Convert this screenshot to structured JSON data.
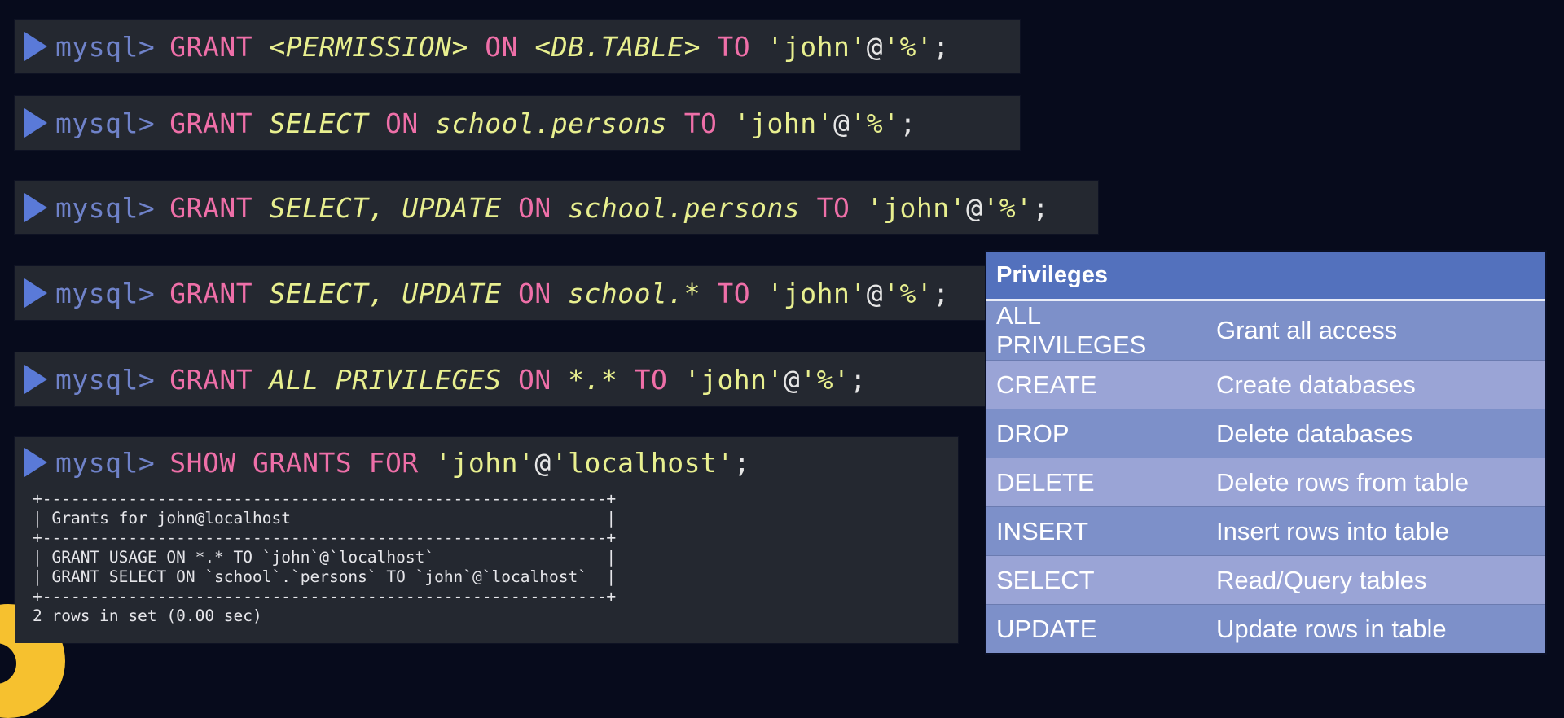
{
  "theme": {
    "background": "#070b1c",
    "terminal_bg": "#242830",
    "prompt_arrow": "#5a7ad8",
    "prompt_text": "#6f82c9",
    "keyword": "#ee6fa8",
    "argument": "#e8ef8f",
    "table_header": "#5371bd",
    "table_row_dark": "#7d90c9",
    "table_row_light": "#9aa4d6",
    "decoration": "#f6c12f"
  },
  "prompt": "mysql>",
  "commands": [
    {
      "tokens": [
        {
          "t": "GRANT",
          "c": "kw"
        },
        {
          "t": " ",
          "c": "punct"
        },
        {
          "t": "<PERMISSION>",
          "c": "arg"
        },
        {
          "t": " ",
          "c": "punct"
        },
        {
          "t": "ON",
          "c": "kw"
        },
        {
          "t": " ",
          "c": "punct"
        },
        {
          "t": "<DB.TABLE>",
          "c": "arg"
        },
        {
          "t": " ",
          "c": "punct"
        },
        {
          "t": "TO",
          "c": "kw"
        },
        {
          "t": " ",
          "c": "punct"
        },
        {
          "t": "'john'",
          "c": "str"
        },
        {
          "t": "@",
          "c": "punct"
        },
        {
          "t": "'%'",
          "c": "str"
        },
        {
          "t": ";",
          "c": "punct"
        }
      ]
    },
    {
      "tokens": [
        {
          "t": "GRANT",
          "c": "kw"
        },
        {
          "t": " ",
          "c": "punct"
        },
        {
          "t": "SELECT",
          "c": "arg"
        },
        {
          "t": " ",
          "c": "punct"
        },
        {
          "t": "ON",
          "c": "kw"
        },
        {
          "t": " ",
          "c": "punct"
        },
        {
          "t": "school.persons",
          "c": "arg"
        },
        {
          "t": " ",
          "c": "punct"
        },
        {
          "t": "TO",
          "c": "kw"
        },
        {
          "t": " ",
          "c": "punct"
        },
        {
          "t": "'john'",
          "c": "str"
        },
        {
          "t": "@",
          "c": "punct"
        },
        {
          "t": "'%'",
          "c": "str"
        },
        {
          "t": ";",
          "c": "punct"
        }
      ]
    },
    {
      "tokens": [
        {
          "t": "GRANT",
          "c": "kw"
        },
        {
          "t": " ",
          "c": "punct"
        },
        {
          "t": "SELECT, UPDATE",
          "c": "arg"
        },
        {
          "t": " ",
          "c": "punct"
        },
        {
          "t": "ON",
          "c": "kw"
        },
        {
          "t": " ",
          "c": "punct"
        },
        {
          "t": "school.persons",
          "c": "arg"
        },
        {
          "t": " ",
          "c": "punct"
        },
        {
          "t": "TO",
          "c": "kw"
        },
        {
          "t": " ",
          "c": "punct"
        },
        {
          "t": "'john'",
          "c": "str"
        },
        {
          "t": "@",
          "c": "punct"
        },
        {
          "t": "'%'",
          "c": "str"
        },
        {
          "t": ";",
          "c": "punct"
        }
      ]
    },
    {
      "tokens": [
        {
          "t": "GRANT",
          "c": "kw"
        },
        {
          "t": " ",
          "c": "punct"
        },
        {
          "t": "SELECT, UPDATE",
          "c": "arg"
        },
        {
          "t": " ",
          "c": "punct"
        },
        {
          "t": "ON",
          "c": "kw"
        },
        {
          "t": " ",
          "c": "punct"
        },
        {
          "t": "school.*",
          "c": "arg"
        },
        {
          "t": " ",
          "c": "punct"
        },
        {
          "t": "TO",
          "c": "kw"
        },
        {
          "t": " ",
          "c": "punct"
        },
        {
          "t": "'john'",
          "c": "str"
        },
        {
          "t": "@",
          "c": "punct"
        },
        {
          "t": "'%'",
          "c": "str"
        },
        {
          "t": ";",
          "c": "punct"
        }
      ]
    },
    {
      "tokens": [
        {
          "t": "GRANT",
          "c": "kw"
        },
        {
          "t": " ",
          "c": "punct"
        },
        {
          "t": "ALL PRIVILEGES",
          "c": "arg"
        },
        {
          "t": " ",
          "c": "punct"
        },
        {
          "t": "ON",
          "c": "kw"
        },
        {
          "t": " ",
          "c": "punct"
        },
        {
          "t": "*.*",
          "c": "arg"
        },
        {
          "t": " ",
          "c": "punct"
        },
        {
          "t": "TO",
          "c": "kw"
        },
        {
          "t": " ",
          "c": "punct"
        },
        {
          "t": "'john'",
          "c": "str"
        },
        {
          "t": "@",
          "c": "punct"
        },
        {
          "t": "'%'",
          "c": "str"
        },
        {
          "t": ";",
          "c": "punct"
        }
      ]
    },
    {
      "tokens": [
        {
          "t": "SHOW GRANTS FOR",
          "c": "kw"
        },
        {
          "t": " ",
          "c": "punct"
        },
        {
          "t": "'john'",
          "c": "str"
        },
        {
          "t": "@",
          "c": "punct"
        },
        {
          "t": "'localhost'",
          "c": "str"
        },
        {
          "t": ";",
          "c": "punct"
        }
      ]
    }
  ],
  "show_grants_output": {
    "border": "+-----------------------------------------------------------+",
    "header": "| Grants for john@localhost                                 |",
    "rows": [
      "| GRANT USAGE ON *.* TO `john`@`localhost`                  |",
      "| GRANT SELECT ON `school`.`persons` TO `john`@`localhost`  |"
    ],
    "footer": "2 rows in set (0.00 sec)"
  },
  "privileges_table": {
    "header": "Privileges",
    "rows": [
      {
        "privilege": "ALL PRIVILEGES",
        "description": "Grant all access"
      },
      {
        "privilege": "CREATE",
        "description": "Create databases"
      },
      {
        "privilege": "DROP",
        "description": "Delete databases"
      },
      {
        "privilege": "DELETE",
        "description": "Delete rows from table"
      },
      {
        "privilege": "INSERT",
        "description": "Insert rows into table"
      },
      {
        "privilege": "SELECT",
        "description": "Read/Query tables"
      },
      {
        "privilege": "UPDATE",
        "description": "Update rows in table"
      }
    ]
  }
}
